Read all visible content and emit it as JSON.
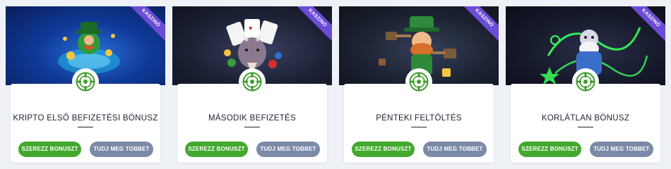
{
  "colors": {
    "page_background": "#eef1f6",
    "primary_button": "#43a82e",
    "secondary_button": "#7c8aa8",
    "ribbon": "#6c4bd6",
    "badge_icon": "#3d9b2d"
  },
  "cards": [
    {
      "ribbon": "KASZINÓ",
      "image_icon": "leprechaun-slot-art",
      "badge_icon": "casino-chip-icon",
      "title": "KRIPTO ELSŐ BEFIZETÉSI BÓNUSZ",
      "primary_button": "SZEREZZ BONUSZT",
      "secondary_button": "TUDJ MEG TOBBET"
    },
    {
      "ribbon": "KASZINÓ",
      "image_icon": "rhino-cards-art",
      "badge_icon": "casino-chip-icon",
      "title": "MÁSODIK BEFIZETÉS",
      "primary_button": "SZEREZZ BONUSZT",
      "secondary_button": "TUDJ MEG TOBBET"
    },
    {
      "ribbon": "KASZINÓ",
      "image_icon": "leprechaun-hammer-art",
      "badge_icon": "casino-chip-icon",
      "title": "PÉNTEKI FELTÖLTÉS",
      "primary_button": "SZEREZZ BONUSZT",
      "secondary_button": "TUDJ MEG TOBBET"
    },
    {
      "ribbon": "KASZINÓ",
      "image_icon": "wizard-neon-art",
      "badge_icon": "casino-chip-icon",
      "title": "KORLÁTLAN BÓNUSZ",
      "primary_button": "SZEREZZ BONUSZT",
      "secondary_button": "TUDJ MEG TOBBET"
    }
  ]
}
